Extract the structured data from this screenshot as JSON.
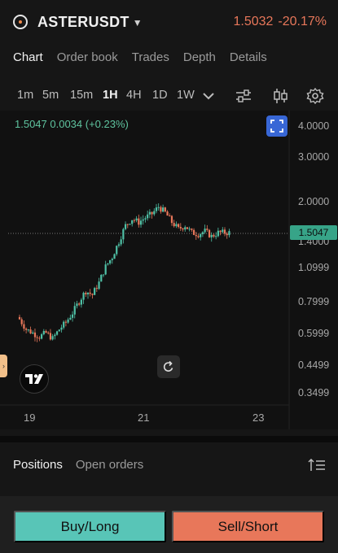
{
  "header": {
    "symbol": "ASTERUSDT",
    "price": "1.5032",
    "change": "-20.17%"
  },
  "tabs": [
    "Chart",
    "Order book",
    "Trades",
    "Depth",
    "Details"
  ],
  "timeframes": [
    "1m",
    "5m",
    "15m",
    "1H",
    "4H",
    "1D",
    "1W"
  ],
  "active_timeframe": "1H",
  "ohlc_line": "1.5047  0.0034 (+0.23%)",
  "current_price_tag": "1.5047",
  "chart_data": {
    "type": "candlestick",
    "y_scale": "log",
    "y_ticks": [
      "4.0000",
      "3.0000",
      "2.0000",
      "1.4000",
      "1.0999",
      "0.7999",
      "0.5999",
      "0.4499",
      "0.3499"
    ],
    "x_ticks": [
      "19",
      "21",
      "23"
    ],
    "last_value": 1.5047,
    "close_path": [
      0.68,
      0.62,
      0.6,
      0.58,
      0.6,
      0.57,
      0.62,
      0.66,
      0.72,
      0.8,
      0.88,
      0.85,
      0.95,
      1.1,
      1.2,
      1.38,
      1.6,
      1.7,
      1.65,
      1.72,
      1.78,
      1.9,
      1.8,
      1.65,
      1.55,
      1.6,
      1.5,
      1.48,
      1.52,
      1.45,
      1.5,
      1.5
    ]
  },
  "positions": {
    "tabs": [
      "Positions",
      "Open orders"
    ]
  },
  "actions": {
    "buy": "Buy/Long",
    "sell": "Sell/Short"
  },
  "colors": {
    "up": "#4fc1a6",
    "down": "#e8775a",
    "accent": "#3867d6"
  }
}
